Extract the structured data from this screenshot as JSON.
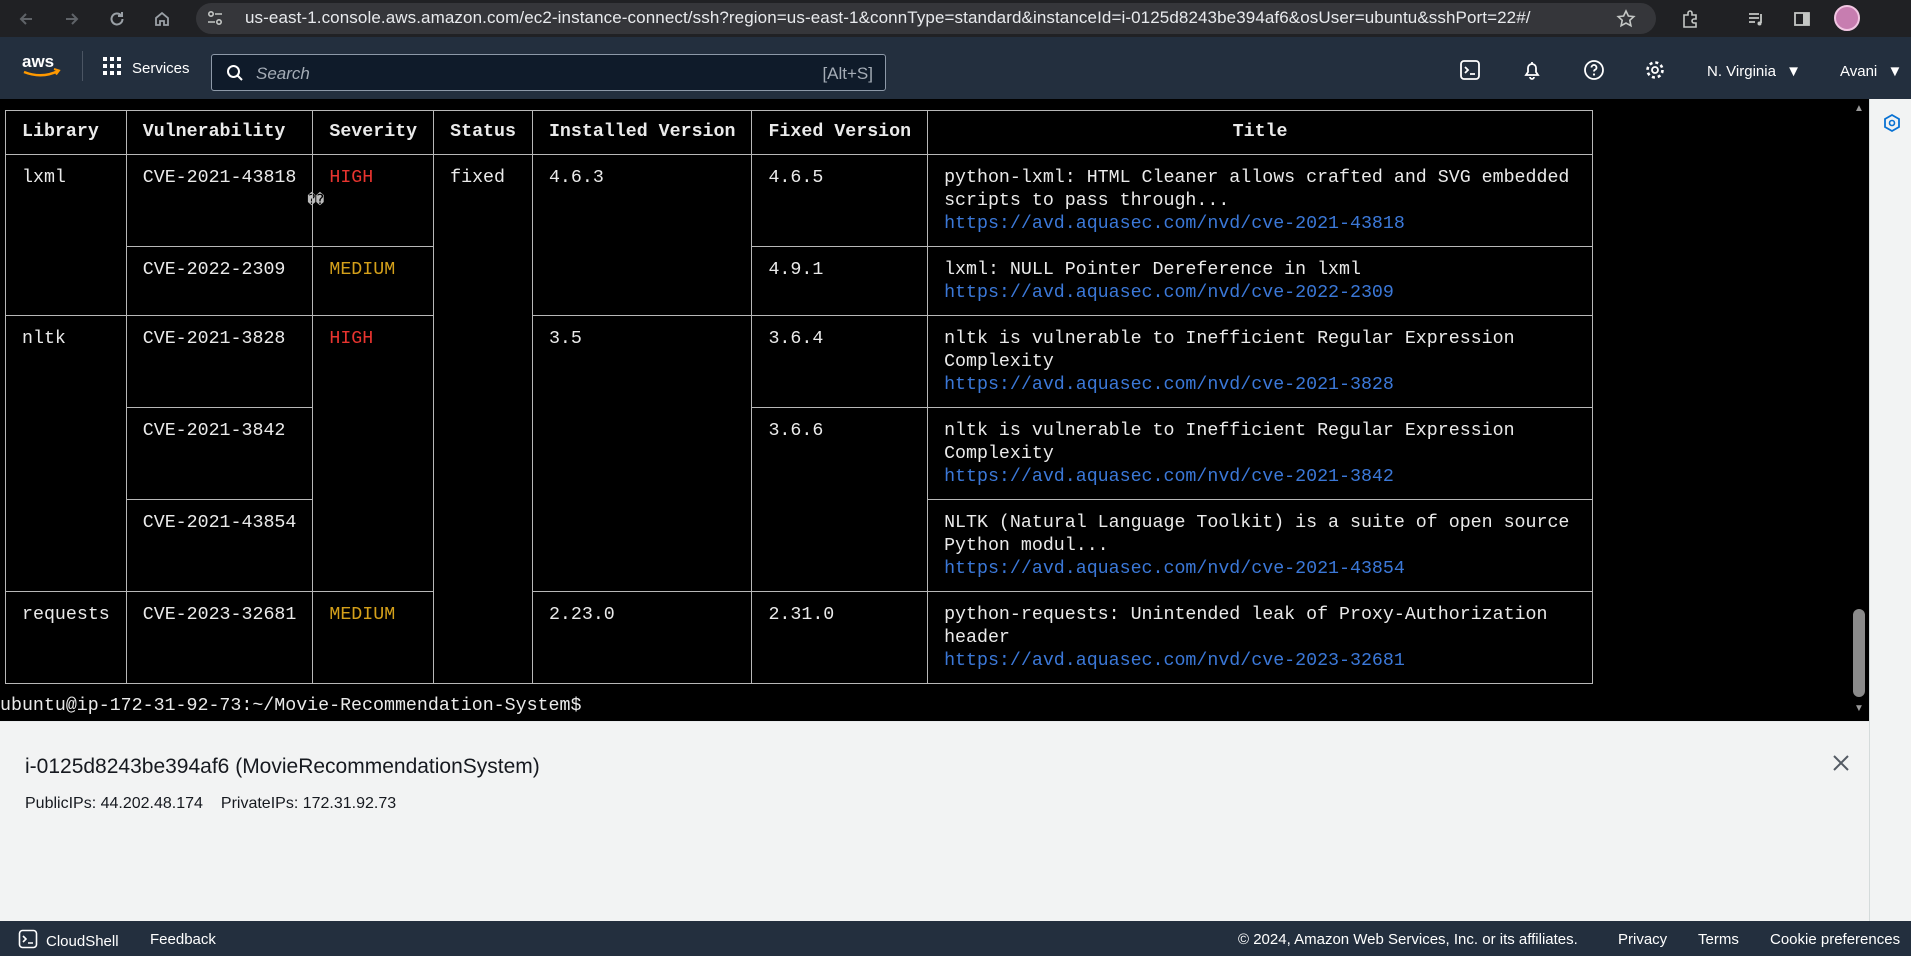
{
  "browser": {
    "url": "us-east-1.console.aws.amazon.com/ec2-instance-connect/ssh?region=us-east-1&connType=standard&instanceId=i-0125d8243be394af6&osUser=ubuntu&sshPort=22#/"
  },
  "aws_nav": {
    "services_label": "Services",
    "search_placeholder": "Search",
    "search_shortcut": "[Alt+S]",
    "region": "N. Virginia",
    "user": "Avani"
  },
  "terminal": {
    "headers": [
      "Library",
      "Vulnerability",
      "Severity",
      "Status",
      "Installed Version",
      "Fixed Version",
      "Title"
    ],
    "rows": [
      {
        "library": "lxml",
        "cve": "CVE-2021-43818",
        "severity": "HIGH",
        "status": "fixed",
        "installed": "4.6.3",
        "fixed": "4.6.5",
        "title": "python-lxml: HTML Cleaner allows crafted and SVG embedded scripts to pass through...",
        "url": "https://avd.aquasec.com/nvd/cve-2021-43818"
      },
      {
        "library": "",
        "cve": "CVE-2022-2309",
        "severity": "MEDIUM",
        "status": "",
        "installed": "",
        "fixed": "4.9.1",
        "title": "lxml: NULL Pointer Dereference in lxml",
        "url": "https://avd.aquasec.com/nvd/cve-2022-2309"
      },
      {
        "library": "nltk",
        "cve": "CVE-2021-3828",
        "severity": "HIGH",
        "status": "",
        "installed": "3.5",
        "fixed": "3.6.4",
        "title": "nltk is vulnerable to Inefficient Regular Expression Complexity",
        "url": "https://avd.aquasec.com/nvd/cve-2021-3828"
      },
      {
        "library": "",
        "cve": "CVE-2021-3842",
        "severity": "",
        "status": "",
        "installed": "",
        "fixed": "3.6.6",
        "title": "nltk is vulnerable to Inefficient Regular Expression Complexity",
        "url": "https://avd.aquasec.com/nvd/cve-2021-3842"
      },
      {
        "library": "",
        "cve": "CVE-2021-43854",
        "severity": "",
        "status": "",
        "installed": "",
        "fixed": "",
        "title": "NLTK (Natural Language Toolkit) is a suite of open source Python modul...",
        "url": "https://avd.aquasec.com/nvd/cve-2021-43854"
      },
      {
        "library": "requests",
        "cve": "CVE-2023-32681",
        "severity": "MEDIUM",
        "status": "",
        "installed": "2.23.0",
        "fixed": "2.31.0",
        "title": "python-requests: Unintended leak of Proxy-Authorization header",
        "url": "https://avd.aquasec.com/nvd/cve-2023-32681"
      }
    ],
    "artifact_glyph": "��",
    "prompt": "ubuntu@ip-172-31-92-73:~/Movie-Recommendation-System$"
  },
  "instance": {
    "title": "i-0125d8243be394af6 (MovieRecommendationSystem)",
    "public_ips": "PublicIPs: 44.202.48.174",
    "private_ips": "PrivateIPs: 172.31.92.73"
  },
  "footer": {
    "cloudshell": "CloudShell",
    "feedback": "Feedback",
    "copyright": "© 2024, Amazon Web Services, Inc. or its affiliates.",
    "privacy": "Privacy",
    "terms": "Terms",
    "cookies": "Cookie preferences"
  },
  "colors": {
    "severity_high": "#e8342f",
    "severity_medium": "#d4a01a",
    "link": "#3b78d8",
    "aws_nav": "#232f3e"
  }
}
